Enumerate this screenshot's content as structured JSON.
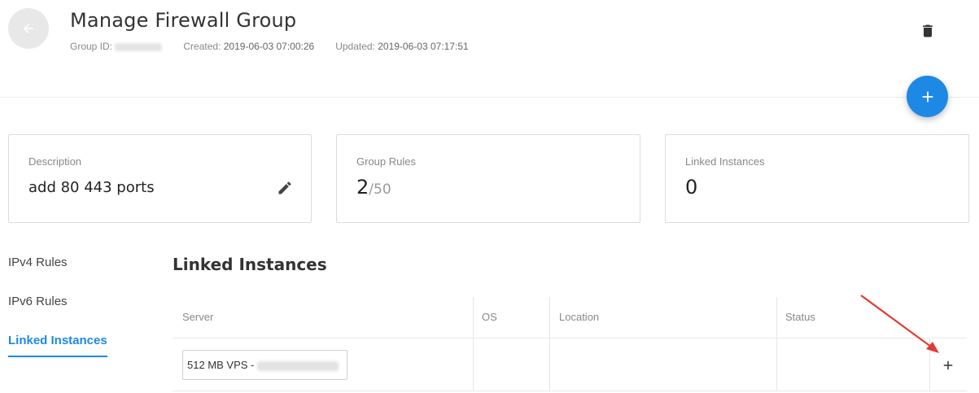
{
  "header": {
    "title": "Manage Firewall Group",
    "group_id_label": "Group ID:",
    "created_label": "Created:",
    "created_value": "2019-06-03 07:00:26",
    "updated_label": "Updated:",
    "updated_value": "2019-06-03 07:17:51"
  },
  "icons": {
    "back": "arrow-left-icon",
    "delete": "trash-icon",
    "add": "plus-icon",
    "edit": "pencil-icon"
  },
  "cards": {
    "description": {
      "label": "Description",
      "value": "add 80 443 ports"
    },
    "group_rules": {
      "label": "Group Rules",
      "value": "2",
      "limit": "/50"
    },
    "linked_instances": {
      "label": "Linked Instances",
      "value": "0"
    }
  },
  "sidenav": {
    "items": [
      {
        "label": "IPv4 Rules",
        "active": false
      },
      {
        "label": "IPv6 Rules",
        "active": false
      },
      {
        "label": "Linked Instances",
        "active": true
      }
    ]
  },
  "section": {
    "title": "Linked Instances"
  },
  "table": {
    "columns": [
      "Server",
      "OS",
      "Location",
      "Status"
    ],
    "server_select_value": "512 MB VPS - "
  },
  "colors": {
    "accent": "#1e88e5",
    "annotation_arrow": "#e53935"
  }
}
